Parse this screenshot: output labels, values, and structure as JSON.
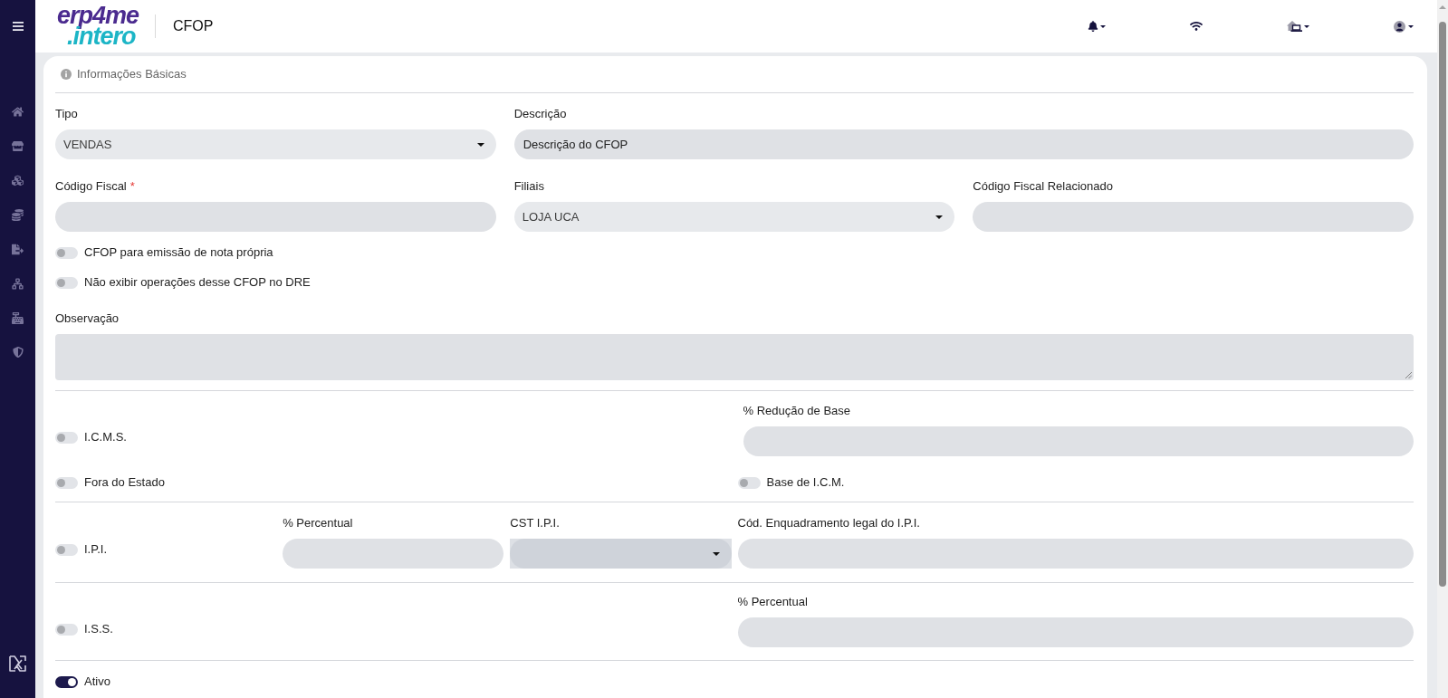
{
  "header": {
    "logo": [
      "erp4me",
      ".intero"
    ],
    "title": "CFOP"
  },
  "section": {
    "title": "Informações Básicas"
  },
  "tipo": {
    "label": "Tipo",
    "value": "VENDAS"
  },
  "descricao": {
    "label": "Descrição",
    "value": "Descrição do CFOP"
  },
  "codigo_fiscal": {
    "label": "Código Fiscal",
    "required_mark": "*"
  },
  "filiais": {
    "label": "Filiais",
    "value": "LOJA UCA"
  },
  "codigo_fiscal_relacionado": {
    "label": "Código Fiscal Relacionado"
  },
  "options": [
    {
      "label": "CFOP para emissão de nota própria",
      "on": false
    },
    {
      "label": "Não exibir operações desse CFOP no DRE",
      "on": false
    }
  ],
  "observacao": {
    "label": "Observação"
  },
  "icms": {
    "toggle": {
      "label": "I.C.M.S.",
      "on": false
    },
    "reducao_base": {
      "label": "% Redução de Base"
    },
    "fora_do_estado": {
      "label": "Fora do Estado",
      "on": false
    },
    "base_icm": {
      "label": "Base de I.C.M.",
      "on": false
    }
  },
  "ipi": {
    "toggle": {
      "label": "I.P.I.",
      "on": false
    },
    "percentual": {
      "label": "% Percentual"
    },
    "cst": {
      "label": "CST I.P.I."
    },
    "enquadramento": {
      "label": "Cód. Enquadramento legal do I.P.I."
    }
  },
  "iss": {
    "toggle": {
      "label": "I.S.S.",
      "on": false
    },
    "percentual": {
      "label": "% Percentual"
    }
  },
  "ativo": {
    "label": "Ativo",
    "on": true
  }
}
